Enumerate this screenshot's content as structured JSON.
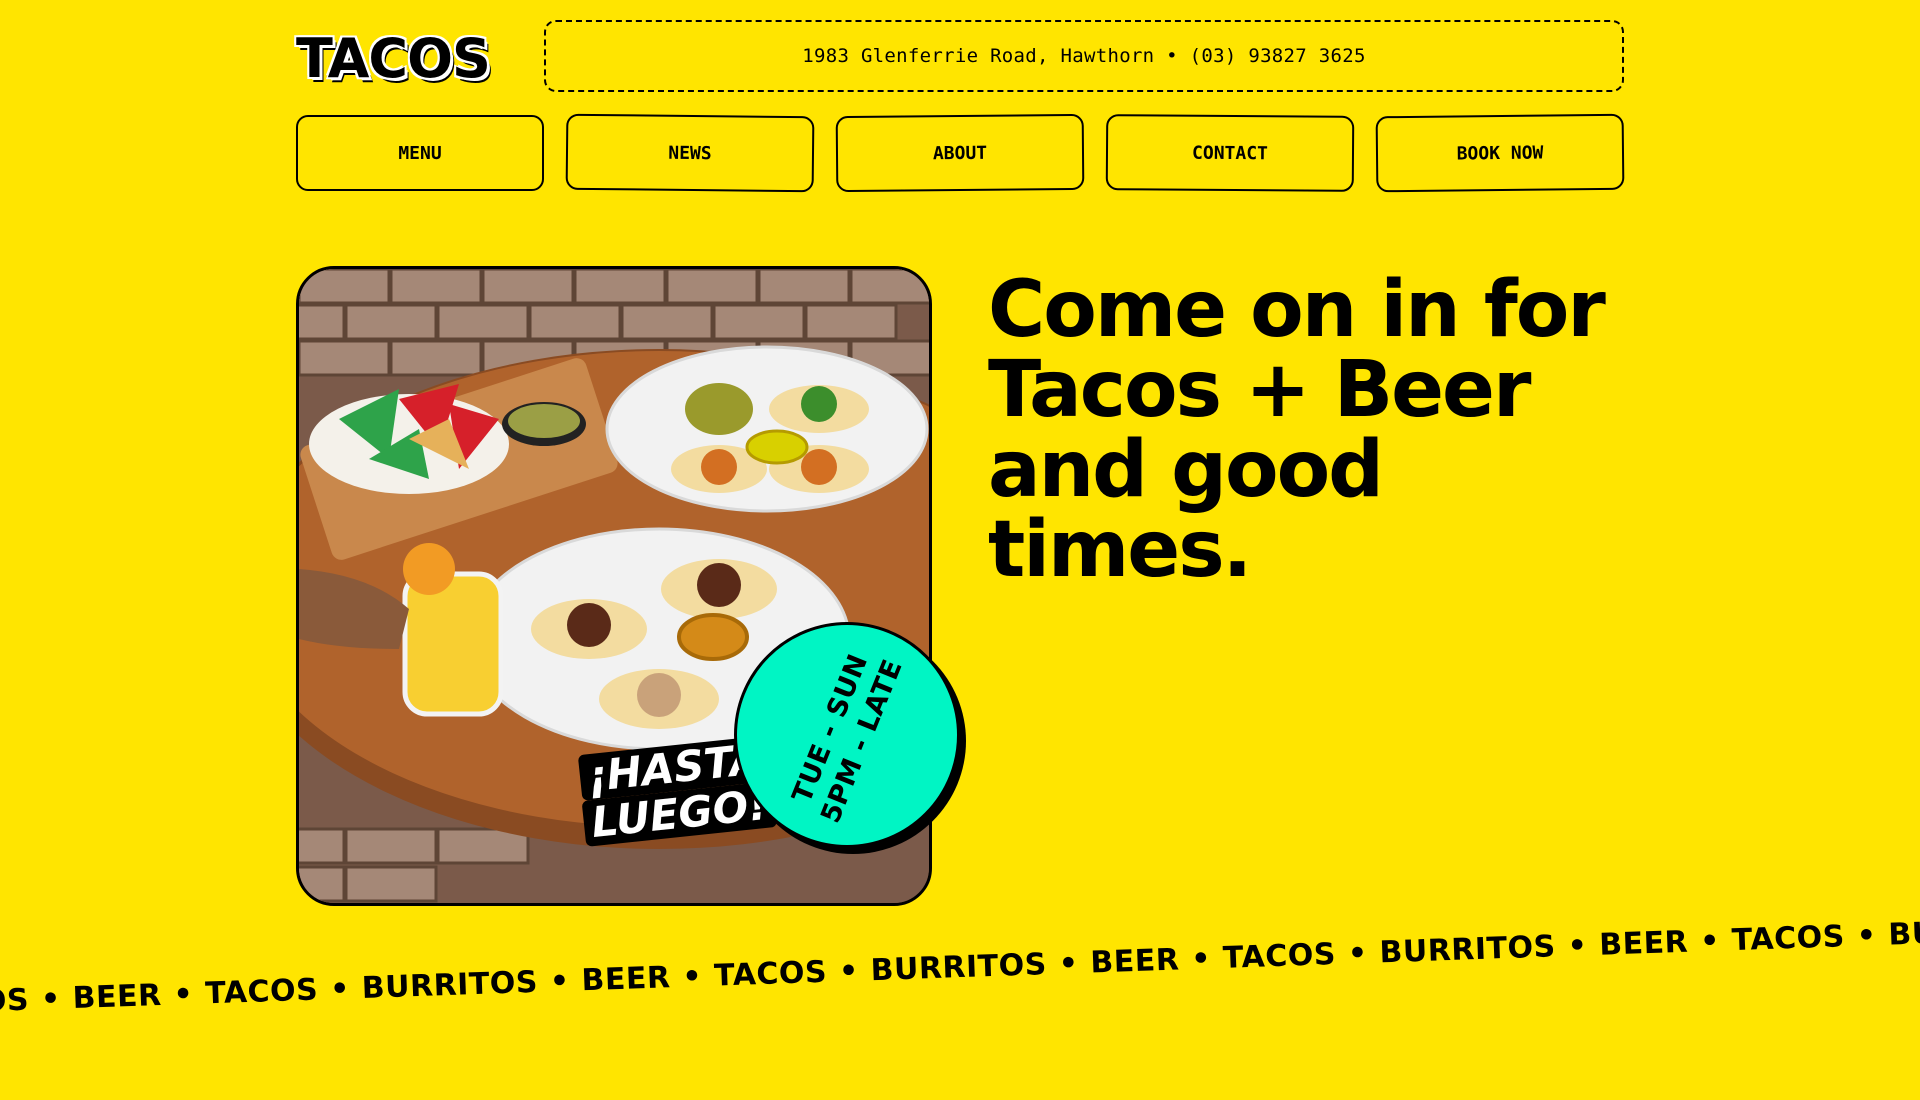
{
  "brand": {
    "logo": "TACOS"
  },
  "header": {
    "address": "1983 Glenferrie Road, Hawthorn • (03) 93827 3625"
  },
  "nav": {
    "items": [
      "MENU",
      "NEWS",
      "ABOUT",
      "CONTACT",
      "BOOK NOW"
    ]
  },
  "hero": {
    "headline": "Come on in for Tacos + Beer and good times.",
    "badge_line1": "TUE - SUN",
    "badge_line2": "5PM - LATE",
    "sticker_line1": "¡HASTA",
    "sticker_line2": "LUEGO!"
  },
  "ticker": {
    "items": [
      "TOS",
      "BEER",
      "TACOS",
      "BURRITOS",
      "BEER",
      "TACOS",
      "BURRITOS",
      "BEER",
      "TACOS",
      "BURRITOS",
      "BEER",
      "TACOS",
      "BURR"
    ]
  },
  "colors": {
    "background": "#FFE500",
    "badge": "#00F5C4",
    "ink": "#000000"
  }
}
